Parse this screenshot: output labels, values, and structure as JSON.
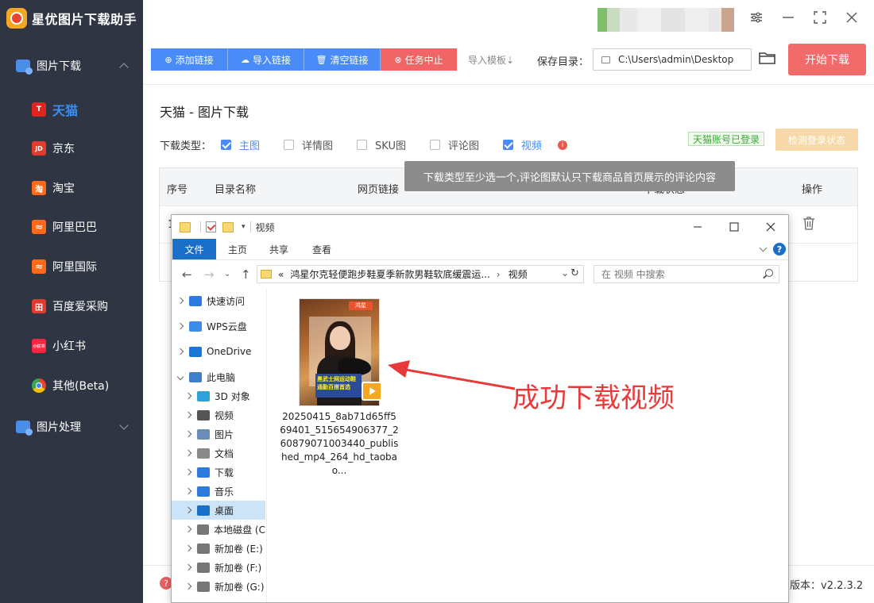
{
  "app": {
    "title": "星优图片下载助手",
    "version": "版本：v2.2.3.2"
  },
  "sidebar": {
    "group_download": "图片下载",
    "items": [
      {
        "label": "天猫",
        "icon": "T",
        "color": "#e0241f"
      },
      {
        "label": "京东",
        "icon": "JD",
        "color": "#e33a2d"
      },
      {
        "label": "淘宝",
        "icon": "淘",
        "color": "#ff6a1a"
      },
      {
        "label": "阿里巴巴",
        "icon": "≈",
        "color": "#ff6a1a"
      },
      {
        "label": "阿里国际",
        "icon": "≈",
        "color": "#ff6a1a"
      },
      {
        "label": "百度爱采购",
        "icon": "田",
        "color": "#e33a2d"
      },
      {
        "label": "小红书",
        "icon": "小红书",
        "color": "#ff2442"
      },
      {
        "label": "其他(Beta)",
        "icon": "chrome-icon",
        "color": "#ffffff"
      }
    ],
    "group_process": "图片处理"
  },
  "toolbar": {
    "add_link": "添加链接",
    "import_link": "导入链接",
    "clear_link": "清空链接",
    "stop_task": "任务中止",
    "import_template": "导入模板⇣",
    "save_dir_label": "保存目录：",
    "save_dir_value": "C:\\Users\\admin\\Desktop",
    "start_download": "开始下载"
  },
  "main": {
    "title": "天猫 - 图片下载",
    "type_label": "下载类型：",
    "types": [
      {
        "label": "主图",
        "checked": true
      },
      {
        "label": "详情图",
        "checked": false
      },
      {
        "label": "SKU图",
        "checked": false
      },
      {
        "label": "评论图",
        "checked": false
      },
      {
        "label": "视频",
        "checked": true
      }
    ],
    "login_status": "天猫账号已登录",
    "check_login": "检测登录状态",
    "tooltip": "下载类型至少选一个,评论图默认只下载商品首页展示的评论内容",
    "table_headers": [
      "序号",
      "目录名称",
      "网页链接",
      "下载状态",
      "操作"
    ],
    "row_index": "1"
  },
  "explorer": {
    "title": "视频",
    "ribbon_tabs": [
      "文件",
      "主页",
      "共享",
      "查看"
    ],
    "address_segments": [
      "«",
      "鸿星尔克轻便跑步鞋夏季新款男鞋软底缓震运...",
      "›",
      "视频"
    ],
    "search_placeholder": "在 视频 中搜索",
    "tree": [
      {
        "label": "快速访问",
        "color": "#2e7be0",
        "open": false
      },
      {
        "label": "WPS云盘",
        "color": "#3a8ee8",
        "open": false
      },
      {
        "label": "OneDrive",
        "color": "#1a78d4",
        "open": false
      },
      {
        "label": "此电脑",
        "color": "#3f7fc9",
        "open": true
      },
      {
        "label": "3D 对象",
        "color": "#2fa3d9",
        "open": false
      },
      {
        "label": "视频",
        "color": "#555",
        "open": false
      },
      {
        "label": "图片",
        "color": "#6b8db5",
        "open": false
      },
      {
        "label": "文档",
        "color": "#8a8a8a",
        "open": false
      },
      {
        "label": "下载",
        "color": "#2e7be0",
        "open": false
      },
      {
        "label": "音乐",
        "color": "#2e7be0",
        "open": false
      },
      {
        "label": "桌面",
        "color": "#1a6fc9",
        "open": false,
        "selected": true
      },
      {
        "label": "本地磁盘 (C",
        "color": "#777",
        "open": false
      },
      {
        "label": "新加卷 (E:)",
        "color": "#777",
        "open": false
      },
      {
        "label": "新加卷 (F:)",
        "color": "#777",
        "open": false
      },
      {
        "label": "新加卷 (G:)",
        "color": "#777",
        "open": false
      }
    ],
    "file_name": "20250415_8ab71d65ff569401_515654906377_260879071003440_published_mp4_264_hd_taobao...",
    "thumb_tag": "鸿星",
    "thumb_banner": "黑武士网运动鞋 通勤百搭首选"
  },
  "annotation": {
    "text": "成功下载视频",
    "color": "#e83a3a"
  },
  "colors": {
    "sidebar_bg": "#2f3542",
    "accent_blue": "#4a8cf7",
    "accent_red": "#f06666"
  }
}
